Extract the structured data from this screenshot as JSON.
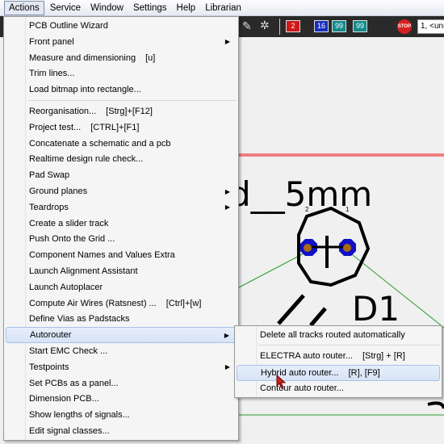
{
  "menubar": [
    "Actions",
    "Service",
    "Window",
    "Settings",
    "Help",
    "Librarian"
  ],
  "toolbar": {
    "badges": [
      {
        "text": "2",
        "color": "#d01818"
      },
      {
        "text": "16",
        "color": "#1a2fc0"
      },
      {
        "text": "99",
        "color": "#138a8a"
      },
      {
        "text": "99",
        "color": "#138a8a"
      }
    ],
    "stop_label": "STOP",
    "layer_select": "1, <unn"
  },
  "canvas": {
    "label_text": "d__5mm",
    "designator": "D1",
    "pads": [
      "2",
      "1"
    ],
    "colors": {
      "pad": "#1010c8",
      "drill": "#a86a10",
      "ratsnest": "#2a9a2a",
      "outline": "#f08080"
    }
  },
  "menu": {
    "items": [
      {
        "label": "PCB Outline Wizard"
      },
      {
        "label": "Front panel",
        "submenu": true
      },
      {
        "label": "Measure and dimensioning",
        "shortcut": "[u]"
      },
      {
        "label": "Trim lines..."
      },
      {
        "label": "Load bitmap into rectangle..."
      },
      {
        "label": "Reorganisation...",
        "shortcut": "[Strg]+[F12]"
      },
      {
        "label": "Project test...",
        "shortcut": "[CTRL]+[F1]"
      },
      {
        "label": "Concatenate a schematic and a pcb"
      },
      {
        "label": "Realtime design rule check..."
      },
      {
        "label": "Pad Swap"
      },
      {
        "label": "Ground planes",
        "submenu": true
      },
      {
        "label": "Teardrops",
        "submenu": true
      },
      {
        "label": "Create a slider track"
      },
      {
        "label": "Push Onto the Grid ..."
      },
      {
        "label": "Component Names and Values Extra"
      },
      {
        "label": "Launch Alignment Assistant"
      },
      {
        "label": "Launch Autoplacer"
      },
      {
        "label": "Compute Air Wires (Ratsnest) ...",
        "shortcut": "[Ctrl]+[w]"
      },
      {
        "label": "Define Vias as Padstacks"
      },
      {
        "label": "Autorouter",
        "submenu": true
      },
      {
        "label": "Start EMC Check ..."
      },
      {
        "label": "Testpoints",
        "submenu": true
      },
      {
        "label": "Set PCBs as a panel..."
      },
      {
        "label": "Dimension PCB..."
      },
      {
        "label": "Show lengths of signals..."
      },
      {
        "label": "Edit signal classes..."
      }
    ]
  },
  "submenu": {
    "items": [
      {
        "label": "Delete all tracks routed automatically"
      },
      {
        "label": "ELECTRA auto router...",
        "shortcut": "[Strg] + [R]"
      },
      {
        "label": "Hybrid auto router...",
        "shortcut": "[R], [F9]"
      },
      {
        "label": "Contour auto router..."
      }
    ]
  }
}
